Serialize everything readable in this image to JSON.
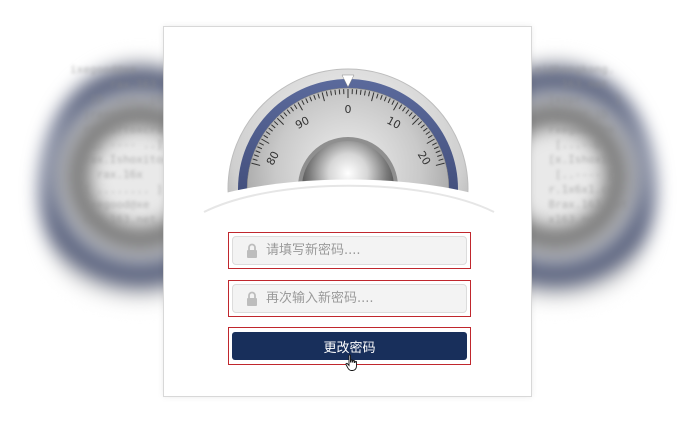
{
  "dial": {
    "ticks": [
      "80",
      "90",
      "0",
      "10",
      "20"
    ]
  },
  "form": {
    "new_password": {
      "placeholder": "请填写新密码....",
      "value": ""
    },
    "confirm_password": {
      "placeholder": "再次输入新密码....",
      "value": ""
    },
    "submit_label": "更改密码"
  },
  "icons": {
    "field_icon": "lock-icon",
    "cursor": "hand-pointer-icon"
  },
  "colors": {
    "button_bg": "#182f5b",
    "highlight_border": "#c0272d",
    "dial_ring": "#3e4a78"
  }
}
